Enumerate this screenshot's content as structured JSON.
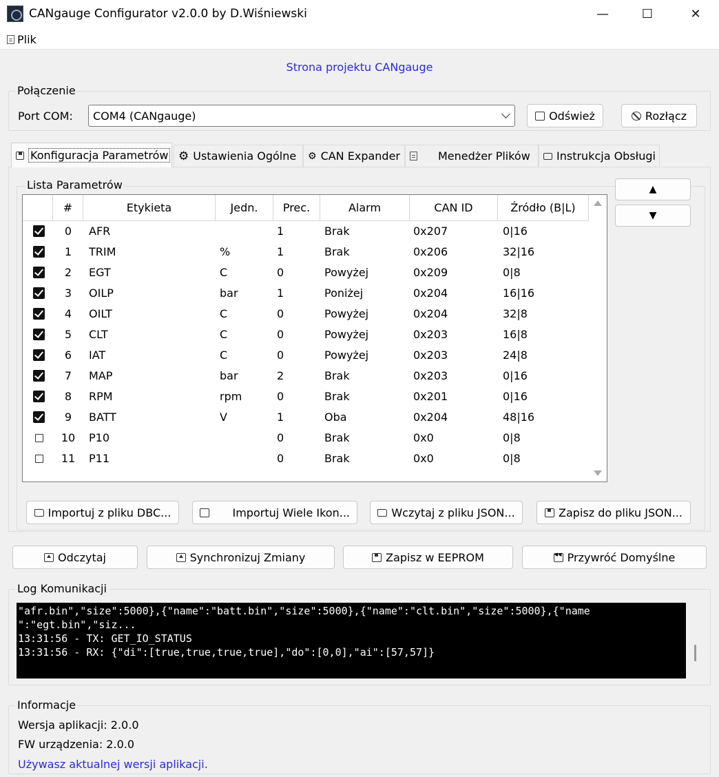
{
  "window": {
    "title": "CANgauge Configurator v2.0.0 by D.Wiśniewski",
    "minimize_glyph": "—",
    "maximize_glyph": "☐",
    "close_glyph": "✕"
  },
  "menu": {
    "file_label": "Plik"
  },
  "project_link": "Strona projektu CANgauge",
  "connection": {
    "group_title": "Połączenie",
    "port_label": "Port COM:",
    "port_value": "COM4 (CANgauge)",
    "refresh_label": "Odśwież",
    "disconnect_label": "Rozłącz"
  },
  "tabs": [
    {
      "label": "Konfiguracja Parametrów",
      "icon": "gauge-icon",
      "active": true
    },
    {
      "label": "Ustawienia Ogólne",
      "icon": "gear-icon"
    },
    {
      "label": "CAN Expander",
      "icon": "gears-icon"
    },
    {
      "label": "Menedżer Plików",
      "icon": "file-icon"
    },
    {
      "label": "Instrukcja Obsługi",
      "icon": "book-icon"
    }
  ],
  "params": {
    "group_title": "Lista Parametrów",
    "columns": [
      "#",
      "Etykieta",
      "Jedn.",
      "Prec.",
      "Alarm",
      "CAN ID",
      "Źródło (B|L)"
    ],
    "rows": [
      {
        "checked": true,
        "idx": "0",
        "label": "AFR",
        "unit": "",
        "prec": "1",
        "alarm": "Brak",
        "can_id": "0x207",
        "source": "0|16"
      },
      {
        "checked": true,
        "idx": "1",
        "label": "TRIM",
        "unit": "%",
        "prec": "1",
        "alarm": "Brak",
        "can_id": "0x206",
        "source": "32|16"
      },
      {
        "checked": true,
        "idx": "2",
        "label": "EGT",
        "unit": "C",
        "prec": "0",
        "alarm": "Powyżej",
        "can_id": "0x209",
        "source": "0|8"
      },
      {
        "checked": true,
        "idx": "3",
        "label": "OILP",
        "unit": "bar",
        "prec": "1",
        "alarm": "Poniżej",
        "can_id": "0x204",
        "source": "16|16"
      },
      {
        "checked": true,
        "idx": "4",
        "label": "OILT",
        "unit": "C",
        "prec": "0",
        "alarm": "Powyżej",
        "can_id": "0x204",
        "source": "32|8"
      },
      {
        "checked": true,
        "idx": "5",
        "label": "CLT",
        "unit": "C",
        "prec": "0",
        "alarm": "Powyżej",
        "can_id": "0x203",
        "source": "16|8"
      },
      {
        "checked": true,
        "idx": "6",
        "label": "IAT",
        "unit": "C",
        "prec": "0",
        "alarm": "Powyżej",
        "can_id": "0x203",
        "source": "24|8"
      },
      {
        "checked": true,
        "idx": "7",
        "label": "MAP",
        "unit": "bar",
        "prec": "2",
        "alarm": "Brak",
        "can_id": "0x203",
        "source": "0|16"
      },
      {
        "checked": true,
        "idx": "8",
        "label": "RPM",
        "unit": "rpm",
        "prec": "0",
        "alarm": "Brak",
        "can_id": "0x201",
        "source": "0|16"
      },
      {
        "checked": true,
        "idx": "9",
        "label": "BATT",
        "unit": "V",
        "prec": "1",
        "alarm": "Oba",
        "can_id": "0x204",
        "source": "48|16"
      },
      {
        "checked": false,
        "idx": "10",
        "label": "P10",
        "unit": "",
        "prec": "0",
        "alarm": "Brak",
        "can_id": "0x0",
        "source": "0|8"
      },
      {
        "checked": false,
        "idx": "11",
        "label": "P11",
        "unit": "",
        "prec": "0",
        "alarm": "Brak",
        "can_id": "0x0",
        "source": "0|8"
      }
    ],
    "move_up_glyph": "▲",
    "move_down_glyph": "▼",
    "import_dbc_label": "Importuj z pliku DBC...",
    "import_icons_label": "Importuj Wiele Ikon...",
    "load_json_label": "Wczytaj z pliku JSON...",
    "save_json_label": "Zapisz do pliku JSON..."
  },
  "actions": {
    "read_label": "Odczytaj",
    "sync_label": "Synchronizuj Zmiany",
    "eeprom_label": "Zapisz w EEPROM",
    "defaults_label": "Przywróć Domyślne"
  },
  "log": {
    "group_title": "Log Komunikacji",
    "lines": [
      "\"afr.bin\",\"size\":5000},{\"name\":\"batt.bin\",\"size\":5000},{\"name\":\"clt.bin\",\"size\":5000},{\"name",
      "\":\"egt.bin\",\"siz...",
      "13:31:56 - TX: GET_IO_STATUS",
      "13:31:56 - RX: {\"di\":[true,true,true,true],\"do\":[0,0],\"ai\":[57,57]}"
    ]
  },
  "info": {
    "group_title": "Informacje",
    "app_version": "Wersja aplikacji: 2.0.0",
    "fw_version": "FW urządzenia: 2.0.0",
    "update_status": "Używasz aktualnej wersji aplikacji."
  },
  "colors": {
    "link": "#2b2bd6",
    "log_bg": "#000000",
    "log_fg": "#ffffff"
  }
}
